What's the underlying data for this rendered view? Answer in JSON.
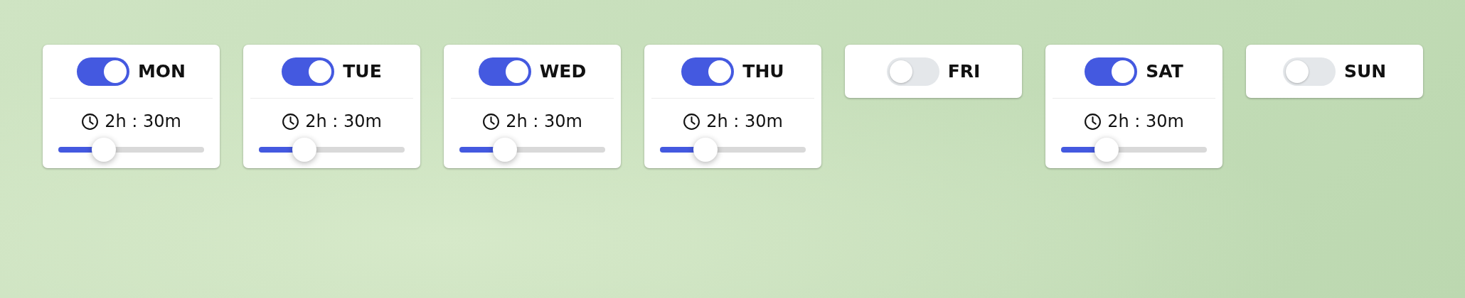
{
  "days": [
    {
      "label": "MON",
      "on": true,
      "time": "2h : 30m",
      "level": 0.31
    },
    {
      "label": "TUE",
      "on": true,
      "time": "2h : 30m",
      "level": 0.31
    },
    {
      "label": "WED",
      "on": true,
      "time": "2h : 30m",
      "level": 0.31
    },
    {
      "label": "THU",
      "on": true,
      "time": "2h : 30m",
      "level": 0.31
    },
    {
      "label": "FRI",
      "on": false
    },
    {
      "label": "SAT",
      "on": true,
      "time": "2h : 30m",
      "level": 0.31
    },
    {
      "label": "SUN",
      "on": false
    }
  ]
}
